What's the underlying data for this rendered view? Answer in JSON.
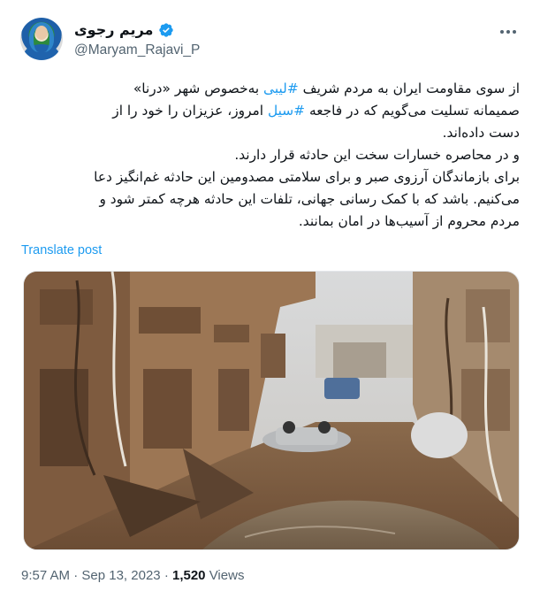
{
  "author": {
    "display_name": "مریم رجوی",
    "handle": "@Maryam_Rajavi_P",
    "verified": true
  },
  "tweet": {
    "line1_pre": "از سوی مقاومت ایران به مردم شریف ",
    "hashtag_libya": "#لیبی",
    "line1_post": " به‌خصوص شهر «درنا»",
    "line2_pre": "صمیمانه تسلیت می‌گویم که در فاجعه ",
    "hashtag_flood": "#سیل",
    "line2_post": " امروز، عزیزان را خود را از",
    "line3": "دست داده‌اند.",
    "line4": "و در محاصره خسارات سخت این حادثه قرار دارند.",
    "line5": "برای بازماندگان آرزوی صبر و برای سلامتی مصدومین این حادثه غم‌انگیز دعا",
    "line6": "می‌کنیم. باشد که با کمک رسانی جهانی، تلفات این حادثه هرچه کمتر شود و",
    "line7": "مردم محروم از آسیب‌ها در امان بمانند."
  },
  "translate_label": "Translate post",
  "meta": {
    "time": "9:57 AM",
    "separator": "·",
    "date": "Sep 13, 2023",
    "views_count": "1,520",
    "views_label": "Views"
  },
  "icons": {
    "verified": "verified-badge-icon",
    "more": "more-options-icon"
  },
  "colors": {
    "link": "#1d9bf0",
    "secondary_text": "#536471",
    "primary_text": "#0f1419"
  }
}
